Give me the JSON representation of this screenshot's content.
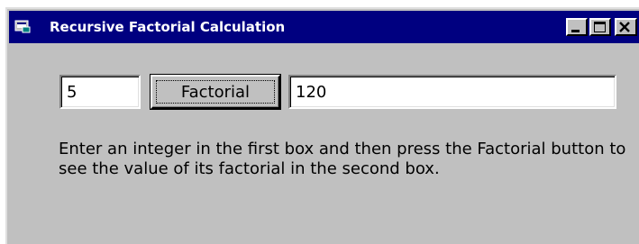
{
  "window": {
    "title": "Recursive Factorial Calculation"
  },
  "form": {
    "input_value": "5",
    "button_label": "Factorial",
    "output_value": "120",
    "instructions": "Enter an integer in the first box and then press the Factorial button to see the value of its factorial in the second box."
  },
  "colors": {
    "titlebar": "#000080",
    "face": "#c0c0c0"
  },
  "icons": {
    "app": "app-icon",
    "minimize": "minimize-icon",
    "maximize": "maximize-icon",
    "close": "close-icon"
  }
}
